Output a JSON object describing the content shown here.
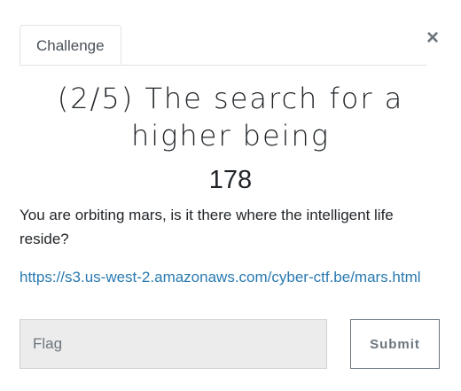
{
  "tabs": [
    {
      "label": "Challenge",
      "active": true
    }
  ],
  "close_glyph": "×",
  "challenge": {
    "title": "(2/5) The search for a higher being",
    "points": "178",
    "description": "You are orbiting mars, is it there where the intelligent life reside?",
    "link": "https://s3.us-west-2.amazonaws.com/cyber-ctf.be/mars.html"
  },
  "form": {
    "flag_placeholder": "Flag",
    "flag_value": "",
    "submit_label": "Submit"
  },
  "colors": {
    "link": "#2a7ab0",
    "input_bg": "#ececec",
    "button_border": "#6c757d"
  }
}
